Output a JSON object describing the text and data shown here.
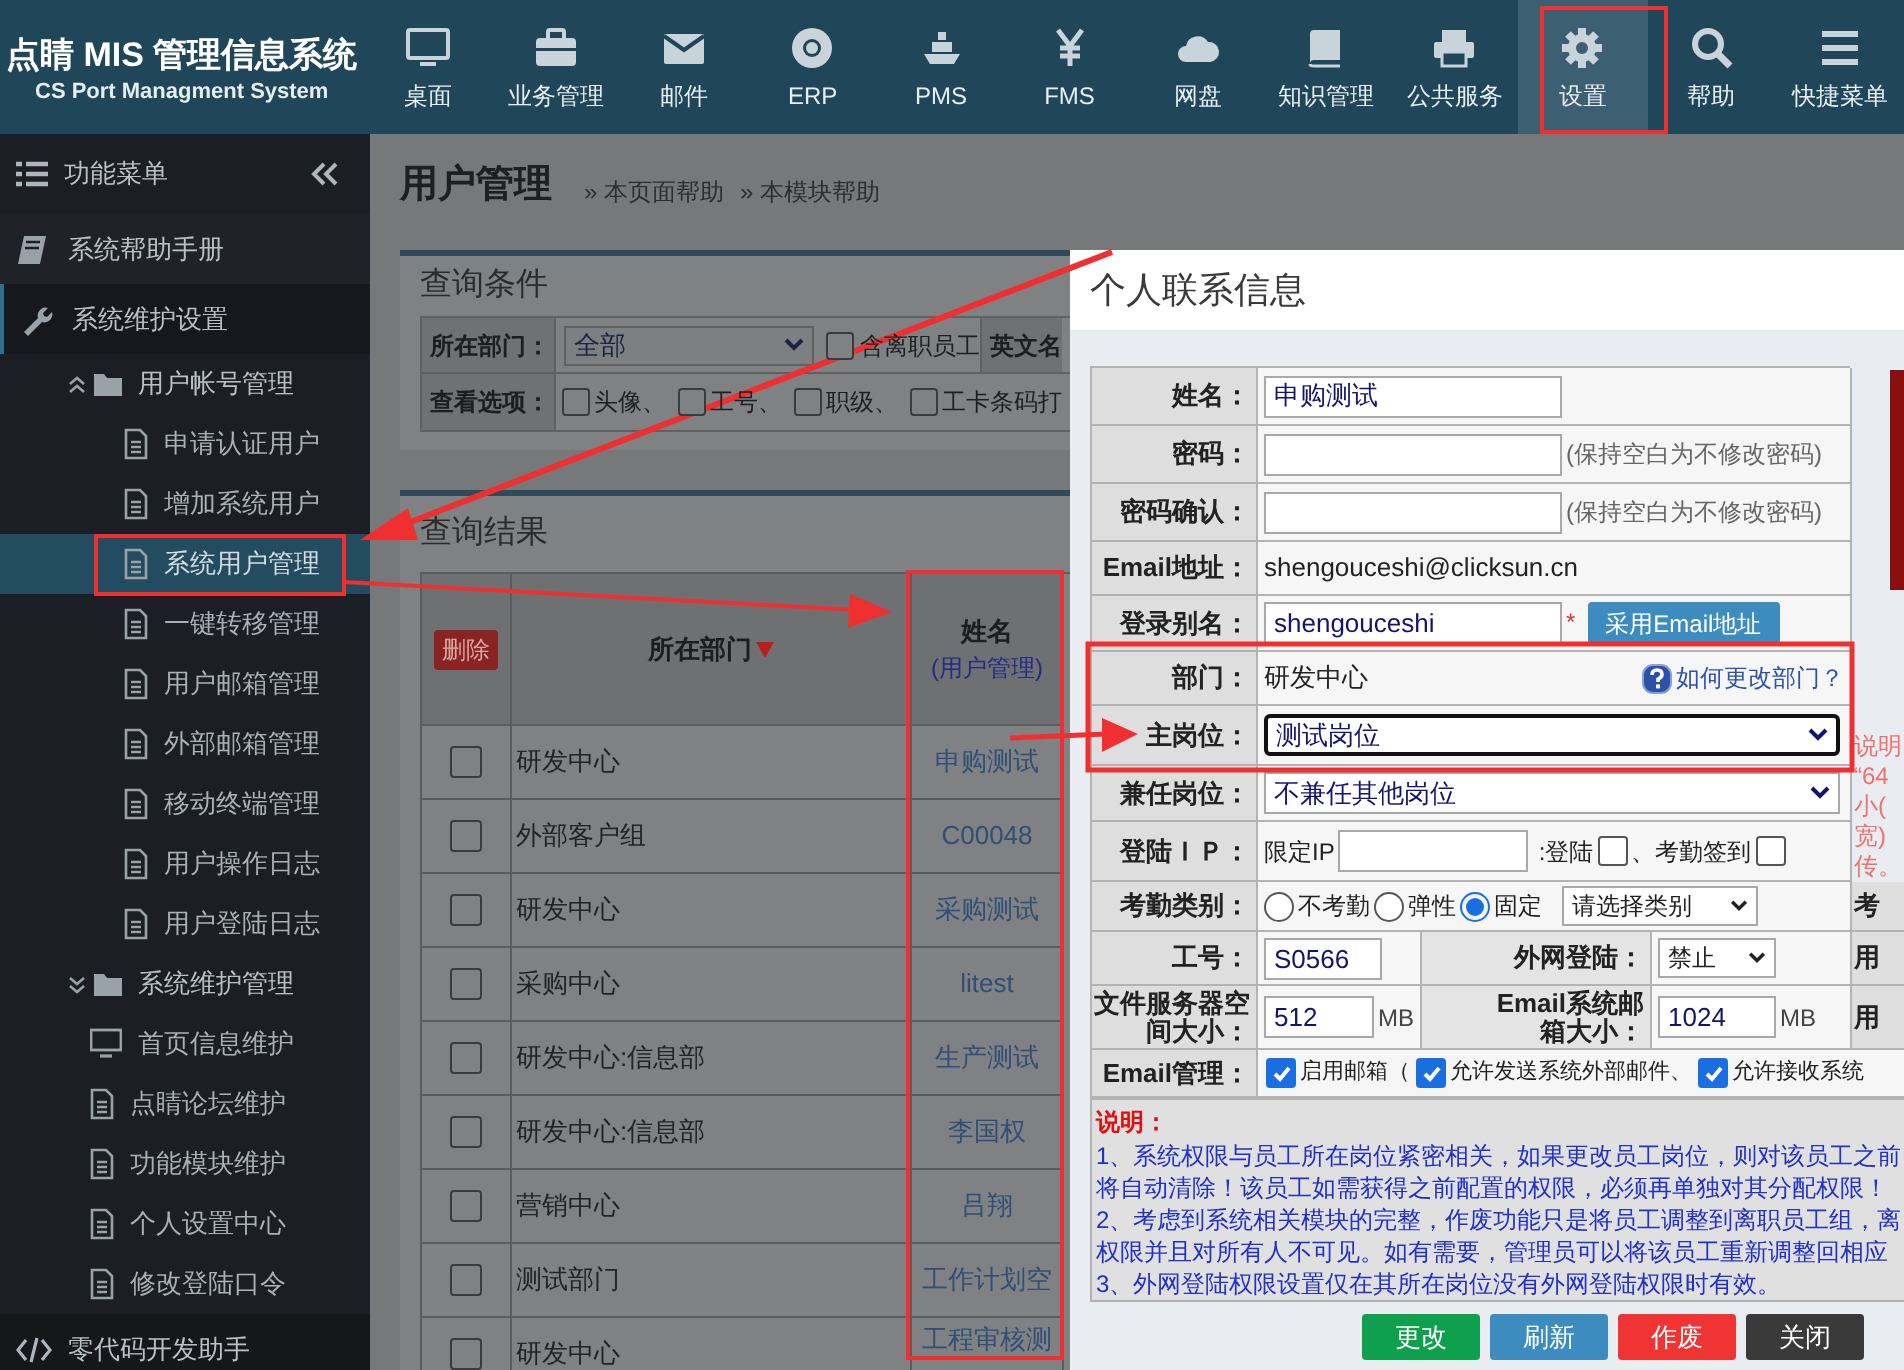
{
  "app": {
    "title": "点睛 MIS 管理信息系统",
    "subtitle": "CS Port Managment System"
  },
  "nav": [
    {
      "label": "桌面",
      "selected": false
    },
    {
      "label": "业务管理",
      "selected": false
    },
    {
      "label": "邮件",
      "selected": false
    },
    {
      "label": "ERP",
      "selected": false
    },
    {
      "label": "PMS",
      "selected": false
    },
    {
      "label": "FMS",
      "selected": false
    },
    {
      "label": "网盘",
      "selected": false
    },
    {
      "label": "知识管理",
      "selected": false
    },
    {
      "label": "公共服务",
      "selected": false
    },
    {
      "label": "设置",
      "selected": true
    },
    {
      "label": "帮助",
      "selected": false
    },
    {
      "label": "快捷菜单",
      "selected": false
    }
  ],
  "sidebar": {
    "title": "功能菜单",
    "items": [
      {
        "label": "系统帮助手册",
        "selected": false
      },
      {
        "label": "系统维护设置",
        "selected": false,
        "children": [
          {
            "label": "用户帐号管理",
            "children": [
              {
                "label": "申请认证用户",
                "selected": false
              },
              {
                "label": "增加系统用户",
                "selected": false
              },
              {
                "label": "系统用户管理",
                "selected": true
              },
              {
                "label": "一键转移管理",
                "selected": false
              },
              {
                "label": "用户邮箱管理",
                "selected": false
              },
              {
                "label": "外部邮箱管理",
                "selected": false
              },
              {
                "label": "移动终端管理",
                "selected": false
              },
              {
                "label": "用户操作日志",
                "selected": false
              },
              {
                "label": "用户登陆日志",
                "selected": false
              }
            ]
          },
          {
            "label": "系统维护管理",
            "children": [
              {
                "label": "首页信息维护",
                "selected": false,
                "kind": "screen"
              },
              {
                "label": "点睛论坛维护",
                "selected": false,
                "kind": "doc"
              },
              {
                "label": "功能模块维护",
                "selected": false,
                "kind": "doc"
              },
              {
                "label": "个人设置中心",
                "selected": false,
                "kind": "doc"
              },
              {
                "label": "修改登陆口令",
                "selected": false,
                "kind": "doc"
              }
            ]
          }
        ]
      },
      {
        "label": "零代码开发助手",
        "selected": false
      }
    ]
  },
  "main": {
    "title": "用户管理",
    "links": [
      "» 本页面帮助",
      "» 本模块帮助"
    ],
    "query": {
      "title": "查询条件",
      "dept_label": "所在部门：",
      "dept_value": "全部",
      "resigned": {
        "label": "含离职员工",
        "checked": false
      },
      "english_label": "英文名",
      "options_label": "查看选项：",
      "options": [
        {
          "label": "头像、",
          "checked": false
        },
        {
          "label": "工号、",
          "checked": false
        },
        {
          "label": "职级、",
          "checked": false
        },
        {
          "label": "工卡条码打",
          "checked": false
        }
      ]
    },
    "results": {
      "title": "查询结果",
      "delete_button": "删除",
      "columns": [
        "所在部门",
        "姓名",
        "(用户管理)"
      ],
      "rows": [
        {
          "checked": false,
          "dept": "研发中心",
          "name": "申购测试"
        },
        {
          "checked": false,
          "dept": "外部客户组",
          "name": "C00048"
        },
        {
          "checked": false,
          "dept": "研发中心",
          "name": "采购测试"
        },
        {
          "checked": false,
          "dept": "采购中心",
          "name": "litest"
        },
        {
          "checked": false,
          "dept": "研发中心:信息部",
          "name": "生产测试"
        },
        {
          "checked": false,
          "dept": "研发中心:信息部",
          "name": "李国权"
        },
        {
          "checked": false,
          "dept": "营销中心",
          "name": "吕翔"
        },
        {
          "checked": false,
          "dept": "测试部门",
          "name": "工作计划空"
        },
        {
          "checked": false,
          "dept": "研发中心",
          "name": "工程审核测"
        }
      ]
    }
  },
  "dialog": {
    "title": "个人联系信息",
    "fields": [
      {
        "kind": "input",
        "label": "姓名：",
        "value": "申购测试"
      },
      {
        "kind": "password",
        "label": "密码：",
        "hint": "(保持空白为不修改密码)"
      },
      {
        "kind": "password",
        "label": "密码确认：",
        "hint": "(保持空白为不修改密码)"
      },
      {
        "kind": "static",
        "label": "Email地址：",
        "value": "shengouceshi@clicksun.cn"
      },
      {
        "kind": "alias",
        "label": "登录别名：",
        "value": "shengouceshi",
        "mark": "*",
        "button": "采用Email地址"
      },
      {
        "kind": "dept",
        "label": "部门：",
        "value": "研发中心",
        "help": "如何更改部门？"
      },
      {
        "kind": "select",
        "label": "主岗位：",
        "value": "测试岗位",
        "focused": true
      },
      {
        "kind": "select",
        "label": "兼任岗位：",
        "value": "不兼任其他岗位",
        "focused": false
      },
      {
        "kind": "ip",
        "label": "登陆ＩＰ：",
        "prefix": "限定IP",
        "login": ":登陆",
        "login_checked": false,
        "attendance": "、考勤签到",
        "attendance_checked": false
      }
    ],
    "side_notes": [
      "说明",
      "“64",
      "小(",
      "宽)",
      "传。"
    ],
    "attendance": {
      "label": "考勤类别：",
      "options": [
        {
          "label": "不考勤",
          "selected": false
        },
        {
          "label": "弹性",
          "selected": false
        },
        {
          "label": "固定",
          "selected": true
        }
      ],
      "select": "请选择类别",
      "extra": "考"
    },
    "staff": {
      "label": "工号：",
      "value": "S0566",
      "web_label": "外网登陆：",
      "web_value": "禁止",
      "extra": "用"
    },
    "quota": {
      "file_label": "文件服务器空间大小：",
      "file_value": "512",
      "file_unit": "MB",
      "mail_label": "Email系统邮箱大小：",
      "mail_value": "1024",
      "mail_unit": "MB",
      "extra": "用"
    },
    "email": {
      "label": "Email管理：",
      "options": [
        {
          "label": "启用邮箱（",
          "checked": true
        },
        {
          "label": "允许发送系统外部邮件、",
          "checked": true
        },
        {
          "label": "允许接收系统",
          "checked": true
        }
      ]
    },
    "notes_title": "说明：",
    "notes": [
      "1、系统权限与员工所在岗位紧密相关，如果更改员工岗位，则对该员工之前",
      "将自动清除！该员工如需获得之前配置的权限，必须再单独对其分配权限！",
      "2、考虑到系统相关模块的完整，作废功能只是将员工调整到离职员工组，离",
      "权限并且对所有人不可见。如有需要，管理员可以将该员工重新调整回相应",
      "3、外网登陆权限设置仅在其所在岗位没有外网登陆权限时有效。"
    ],
    "buttons": [
      {
        "label": "更改",
        "kind": "save"
      },
      {
        "label": "刷新",
        "kind": "refresh"
      },
      {
        "label": "作废",
        "kind": "void"
      },
      {
        "label": "关闭",
        "kind": "close"
      }
    ]
  }
}
